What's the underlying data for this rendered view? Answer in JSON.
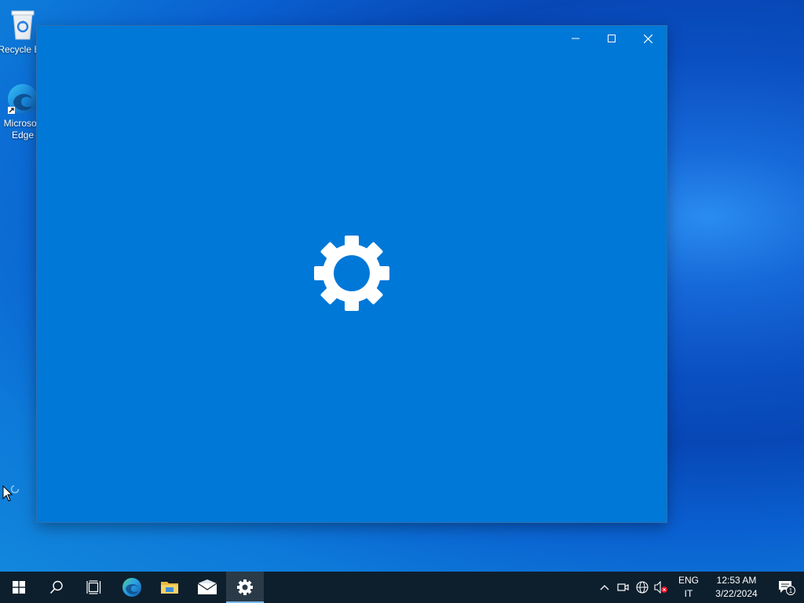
{
  "desktop": {
    "icons": [
      {
        "label": "Recycle Bin",
        "icon": "recycle-bin-icon"
      },
      {
        "label": "Microsoft Edge",
        "icon": "edge-icon"
      }
    ]
  },
  "window": {
    "app": "Settings",
    "splash_icon": "gear-icon",
    "background": "#0078d7",
    "controls": [
      "minimize",
      "maximize",
      "close"
    ]
  },
  "taskbar": {
    "items": [
      {
        "name": "start",
        "icon": "windows-logo-icon"
      },
      {
        "name": "search",
        "icon": "search-icon"
      },
      {
        "name": "task-view",
        "icon": "task-view-icon"
      },
      {
        "name": "edge",
        "icon": "edge-icon"
      },
      {
        "name": "file-explorer",
        "icon": "folder-icon"
      },
      {
        "name": "mail",
        "icon": "mail-icon"
      },
      {
        "name": "settings",
        "icon": "gear-icon",
        "active": true
      }
    ],
    "tray": {
      "lang_top": "ENG",
      "lang_bottom": "IT",
      "time": "12:53 AM",
      "date": "3/22/2024",
      "notification_count": "1"
    }
  },
  "colors": {
    "accent": "#0078d7",
    "taskbar": "#0d1f2d",
    "active_indicator": "#76b9ed"
  }
}
